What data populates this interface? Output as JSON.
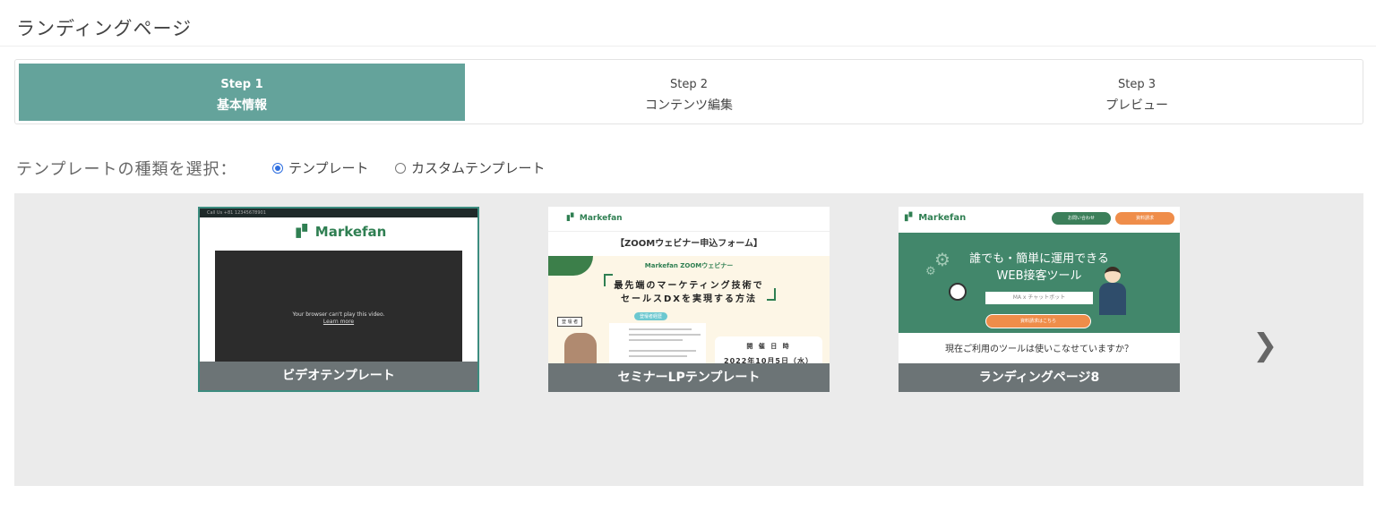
{
  "page": {
    "title": "ランディングページ"
  },
  "stepper": {
    "steps": [
      {
        "num": "Step 1",
        "name": "基本情報",
        "active": true
      },
      {
        "num": "Step 2",
        "name": "コンテンツ編集",
        "active": false
      },
      {
        "num": "Step 3",
        "name": "プレビュー",
        "active": false
      }
    ]
  },
  "template_type": {
    "label": "テンプレートの種類を選択：",
    "options": [
      {
        "label": "テンプレート",
        "checked": true
      },
      {
        "label": "カスタムテンプレート",
        "checked": false
      }
    ]
  },
  "templates": [
    {
      "caption": "ビデオテンプレート",
      "preview": {
        "topbar": "Call Us +81 12345678901",
        "logo": "Markefan",
        "video_msg": "Your browser can't play this video.",
        "video_link": "Learn more"
      }
    },
    {
      "caption": "セミナーLPテンプレート",
      "preview": {
        "logo": "Markefan",
        "form_title": "【ZOOMウェビナー申込フォーム】",
        "sub": "Markefan ZOOMウェビナー",
        "headline_1": "最先端のマーケティング技術で",
        "headline_2": "セールスDXを実現する方法",
        "speaker_label": "登 壇 者",
        "badge": "登壇者経歴",
        "date_label": "開 催 日 時",
        "date": "2022年10月5日（水）"
      }
    },
    {
      "caption": "ランディングページ8",
      "preview": {
        "logo": "Markefan",
        "btn_contact": "お問い合わせ",
        "btn_docs": "資料請求",
        "headline_1": "誰でも・簡単に運用できる",
        "headline_2": "WEB接客ツール",
        "pill": "MA x チャットボット",
        "cta": "資料請求はこちら",
        "question": "現在ご利用のツールは使いこなせていますか？"
      }
    }
  ],
  "colors": {
    "accent": "#64a39b",
    "caption_bg": "#6c7476",
    "radio": "#2f6fe0",
    "brand_green": "#2f7f52",
    "orange": "#ef8d4a"
  },
  "icons": {
    "next": "chevron-right-icon"
  }
}
